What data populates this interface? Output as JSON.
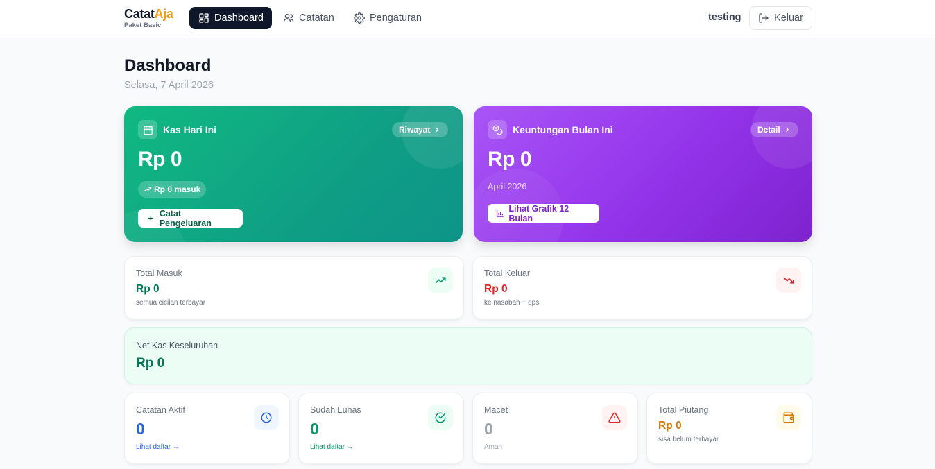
{
  "nav": {
    "brand_part1": "Catat",
    "brand_part2": "Aja",
    "plan": "Paket Basic",
    "links": [
      {
        "label": "Dashboard",
        "icon": "dashboard-grid-icon",
        "active": true
      },
      {
        "label": "Catatan",
        "icon": "users-icon",
        "active": false
      },
      {
        "label": "Pengaturan",
        "icon": "gear-icon",
        "active": false
      }
    ],
    "user": "testing",
    "logout_label": "Keluar"
  },
  "header": {
    "title": "Dashboard",
    "date": "Selasa, 7 April 2026"
  },
  "kas_card": {
    "title": "Kas Hari Ini",
    "link_label": "Riwayat",
    "value": "Rp 0",
    "tag": "Rp 0 masuk",
    "button_label": "Catat Pengeluaran",
    "icon": "calendar-icon"
  },
  "profit_card": {
    "title": "Keuntungan Bulan Ini",
    "link_label": "Detail",
    "value": "Rp 0",
    "period": "April 2026",
    "button_label": "Lihat Grafik 12 Bulan",
    "icon": "coins-icon"
  },
  "total_masuk": {
    "label": "Total Masuk",
    "value": "Rp 0",
    "note": "semua cicilan terbayar",
    "color": "#047857"
  },
  "total_keluar": {
    "label": "Total Keluar",
    "value": "Rp 0",
    "note": "ke nasabah + ops",
    "color": "#dc2626"
  },
  "net_kas": {
    "label": "Net Kas Keseluruhan",
    "value": "Rp 0"
  },
  "stats": {
    "aktif": {
      "label": "Catatan Aktif",
      "value": "0",
      "note": "Lihat daftar →",
      "color": "#2563eb"
    },
    "lunas": {
      "label": "Sudah Lunas",
      "value": "0",
      "note": "Lihat daftar →",
      "color": "#059669"
    },
    "macet": {
      "label": "Macet",
      "value": "0",
      "note": "Aman",
      "color": "#9ca3af"
    },
    "piutang": {
      "label": "Total Piutang",
      "value": "Rp 0",
      "note": "sisa belum terbayar",
      "color": "#d97706"
    }
  },
  "colors": {
    "green_gradient_start": "#10b981",
    "purple_gradient_start": "#a855f7",
    "nav_active": "#0f172a",
    "brand_accent": "#f59e0b"
  }
}
